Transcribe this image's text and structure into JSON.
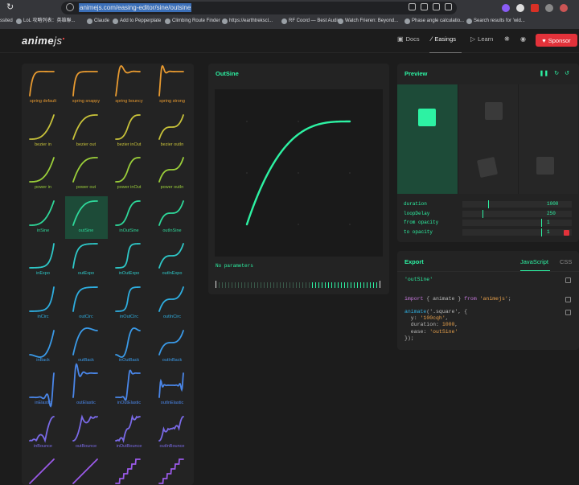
{
  "browser": {
    "url": "animejs.com/easing-editor/sine/outsine",
    "bookmarks": [
      "ssited",
      "LoL 攻略列表：英雄聯...",
      "Claude",
      "Add to Pepperplate",
      "Climbing Route Finder",
      "https://earthtrekscl...",
      "RF Coord — Best Audio",
      "Watch Frieren: Beyond...",
      "Phase angle calculatio...",
      "Search results for 'wid..."
    ]
  },
  "header": {
    "logo": "anime",
    "logo_suffix": "js",
    "nav": [
      {
        "icon": "docs-icon",
        "label": "Docs"
      },
      {
        "icon": "easings-icon",
        "label": "Easings"
      },
      {
        "icon": "learn-icon",
        "label": "Learn"
      }
    ],
    "sponsor_label": "Sponsor"
  },
  "easings": [
    {
      "label": "spring default",
      "color": "#e89a30",
      "curve": "spring1"
    },
    {
      "label": "spring snappy",
      "color": "#e89a30",
      "curve": "spring2"
    },
    {
      "label": "spring bouncy",
      "color": "#e89a30",
      "curve": "spring3"
    },
    {
      "label": "spring strong",
      "color": "#e89a30",
      "curve": "spring4"
    },
    {
      "label": "bezier in",
      "color": "#c8c23a",
      "curve": "in"
    },
    {
      "label": "bezier out",
      "color": "#c8c23a",
      "curve": "out"
    },
    {
      "label": "bezier inOut",
      "color": "#c8c23a",
      "curve": "inout"
    },
    {
      "label": "bezier outIn",
      "color": "#c8c23a",
      "curve": "outin"
    },
    {
      "label": "power in",
      "color": "#9bcf3a",
      "curve": "in"
    },
    {
      "label": "power out",
      "color": "#9bcf3a",
      "curve": "out"
    },
    {
      "label": "power inOut",
      "color": "#9bcf3a",
      "curve": "inout"
    },
    {
      "label": "power outIn",
      "color": "#9bcf3a",
      "curve": "outin"
    },
    {
      "label": "inSine",
      "color": "#2ed89a",
      "curve": "in"
    },
    {
      "label": "outSine",
      "color": "#2ed89a",
      "curve": "out"
    },
    {
      "label": "inOutSine",
      "color": "#2ed89a",
      "curve": "inout"
    },
    {
      "label": "outInSine",
      "color": "#2ed89a",
      "curve": "outin"
    },
    {
      "label": "inExpo",
      "color": "#2ec8c8",
      "curve": "in2"
    },
    {
      "label": "outExpo",
      "color": "#2ec8c8",
      "curve": "out2"
    },
    {
      "label": "inOutExpo",
      "color": "#2ec8c8",
      "curve": "inout2"
    },
    {
      "label": "outInExpo",
      "color": "#2ec8c8",
      "curve": "outin"
    },
    {
      "label": "inCirc",
      "color": "#2eaee0",
      "curve": "in2"
    },
    {
      "label": "outCirc",
      "color": "#2eaee0",
      "curve": "out2"
    },
    {
      "label": "inOutCirc",
      "color": "#2eaee0",
      "curve": "inout2"
    },
    {
      "label": "outInCirc",
      "color": "#2eaee0",
      "curve": "outin"
    },
    {
      "label": "inBack",
      "color": "#3a9ae8",
      "curve": "inback"
    },
    {
      "label": "outBack",
      "color": "#3a9ae8",
      "curve": "outback"
    },
    {
      "label": "inOutBack",
      "color": "#3a9ae8",
      "curve": "inoutback"
    },
    {
      "label": "outInBack",
      "color": "#3a9ae8",
      "curve": "outin"
    },
    {
      "label": "inElastic",
      "color": "#4a86e8",
      "curve": "inelastic"
    },
    {
      "label": "outElastic",
      "color": "#4a86e8",
      "curve": "outelastic"
    },
    {
      "label": "inOutElastic",
      "color": "#4a86e8",
      "curve": "inoutelastic"
    },
    {
      "label": "outInElastic",
      "color": "#4a86e8",
      "curve": "outinelastic"
    },
    {
      "label": "inBounce",
      "color": "#7a6ae8",
      "curve": "inbounce"
    },
    {
      "label": "outBounce",
      "color": "#7a6ae8",
      "curve": "outbounce"
    },
    {
      "label": "inOutBounce",
      "color": "#7a6ae8",
      "curve": "inoutbounce"
    },
    {
      "label": "outInBounce",
      "color": "#7a6ae8",
      "curve": "outinbounce"
    },
    {
      "label": "",
      "color": "#9a5ae8",
      "curve": "linear"
    },
    {
      "label": "",
      "color": "#9a5ae8",
      "curve": "linear"
    },
    {
      "label": "",
      "color": "#9a5ae8",
      "curve": "steps"
    },
    {
      "label": "",
      "color": "#9a5ae8",
      "curve": "steps"
    }
  ],
  "selected_index": 13,
  "editor": {
    "title": "OutSine",
    "no_params": "No parameters"
  },
  "preview": {
    "title": "Preview",
    "params": [
      {
        "label": "duration",
        "value": "1000",
        "fraction": 0.32
      },
      {
        "label": "loopDelay",
        "value": "250",
        "fraction": 0.25
      },
      {
        "label": "from opacity",
        "value": "1",
        "fraction": 0.98
      },
      {
        "label": "to opacity",
        "value": "1",
        "fraction": 0.98
      }
    ]
  },
  "export": {
    "title": "Export",
    "tab_js": "JavaScript",
    "tab_css": "CSS",
    "easing_string": "'outSine'",
    "import_line": {
      "kw1": "import",
      "mid": " { animate } ",
      "kw2": "from",
      "str": " 'animejs'",
      "end": ";"
    },
    "code_lines": [
      {
        "a": "animate",
        "b": "('.square', {"
      },
      {
        "a": "  y: ",
        "s": "'100cqh'",
        "b": ","
      },
      {
        "a": "  duration: ",
        "s": "1000",
        "b": ","
      },
      {
        "a": "  ease: ",
        "s": "'outSine'"
      },
      {
        "a": "});"
      }
    ]
  },
  "colors": {
    "accent": "#2df2a3",
    "sponsor": "#e2323a"
  }
}
